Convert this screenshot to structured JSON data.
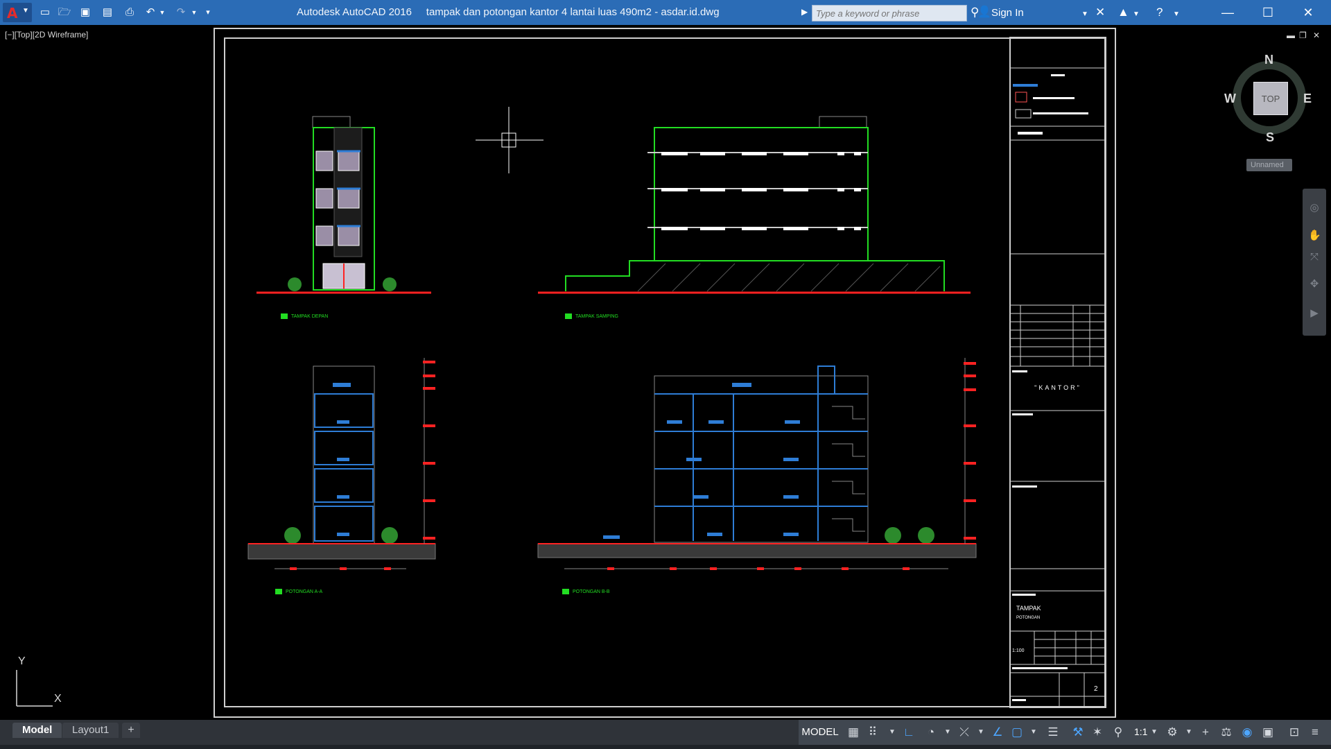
{
  "titlebar": {
    "app_name": "Autodesk AutoCAD 2016",
    "file_name": "tampak dan potongan kantor 4 lantai luas 490m2 - asdar.id.dwg",
    "search_placeholder": "Type a keyword or phrase",
    "sign_in": "Sign In"
  },
  "viewport": {
    "label": "[−][Top][2D Wireframe]"
  },
  "drawings": {
    "label_front": "TAMPAK DEPAN",
    "label_side": "TAMPAK SAMPING",
    "label_section_aa": "POTONGAN A-A",
    "label_section_bb": "POTONGAN B-B"
  },
  "title_block": {
    "project": "\"KANTOR\"",
    "sheet_title_1": "TAMPAK",
    "sheet_title_2": "POTONGAN",
    "scale": "1:100",
    "sheet_number": "2"
  },
  "viewcube": {
    "north": "N",
    "south": "S",
    "east": "E",
    "west": "W",
    "face": "TOP",
    "wcs": "Unnamed"
  },
  "ucs": {
    "x": "X",
    "y": "Y"
  },
  "tabs": {
    "model": "Model",
    "layout1": "Layout1",
    "add": "+"
  },
  "status": {
    "model": "MODEL",
    "scale": "1:1"
  }
}
